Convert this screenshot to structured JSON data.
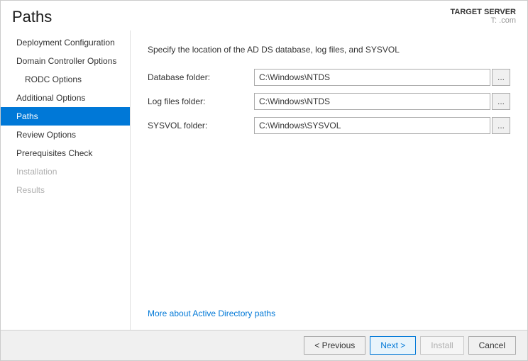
{
  "header": {
    "title": "Paths",
    "target_server_label": "TARGET SERVER",
    "target_server_value": "T:                .com"
  },
  "sidebar": {
    "items": [
      {
        "id": "deployment-configuration",
        "label": "Deployment Configuration",
        "state": "normal",
        "indent": false
      },
      {
        "id": "domain-controller-options",
        "label": "Domain Controller Options",
        "state": "normal",
        "indent": false
      },
      {
        "id": "rodc-options",
        "label": "RODC Options",
        "state": "normal",
        "indent": true
      },
      {
        "id": "additional-options",
        "label": "Additional Options",
        "state": "normal",
        "indent": false
      },
      {
        "id": "paths",
        "label": "Paths",
        "state": "active",
        "indent": false
      },
      {
        "id": "review-options",
        "label": "Review Options",
        "state": "normal",
        "indent": false
      },
      {
        "id": "prerequisites-check",
        "label": "Prerequisites Check",
        "state": "normal",
        "indent": false
      },
      {
        "id": "installation",
        "label": "Installation",
        "state": "disabled",
        "indent": false
      },
      {
        "id": "results",
        "label": "Results",
        "state": "disabled",
        "indent": false
      }
    ]
  },
  "content": {
    "description": "Specify the location of the AD DS database, log files, and SYSVOL",
    "fields": [
      {
        "id": "database-folder",
        "label": "Database folder:",
        "value": "C:\\Windows\\NTDS"
      },
      {
        "id": "log-files-folder",
        "label": "Log files folder:",
        "value": "C:\\Windows\\NTDS"
      },
      {
        "id": "sysvol-folder",
        "label": "SYSVOL folder:",
        "value": "C:\\Windows\\SYSVOL"
      }
    ],
    "more_link": "More about Active Directory paths",
    "browse_button_label": "..."
  },
  "footer": {
    "previous_label": "< Previous",
    "next_label": "Next >",
    "install_label": "Install",
    "cancel_label": "Cancel"
  }
}
